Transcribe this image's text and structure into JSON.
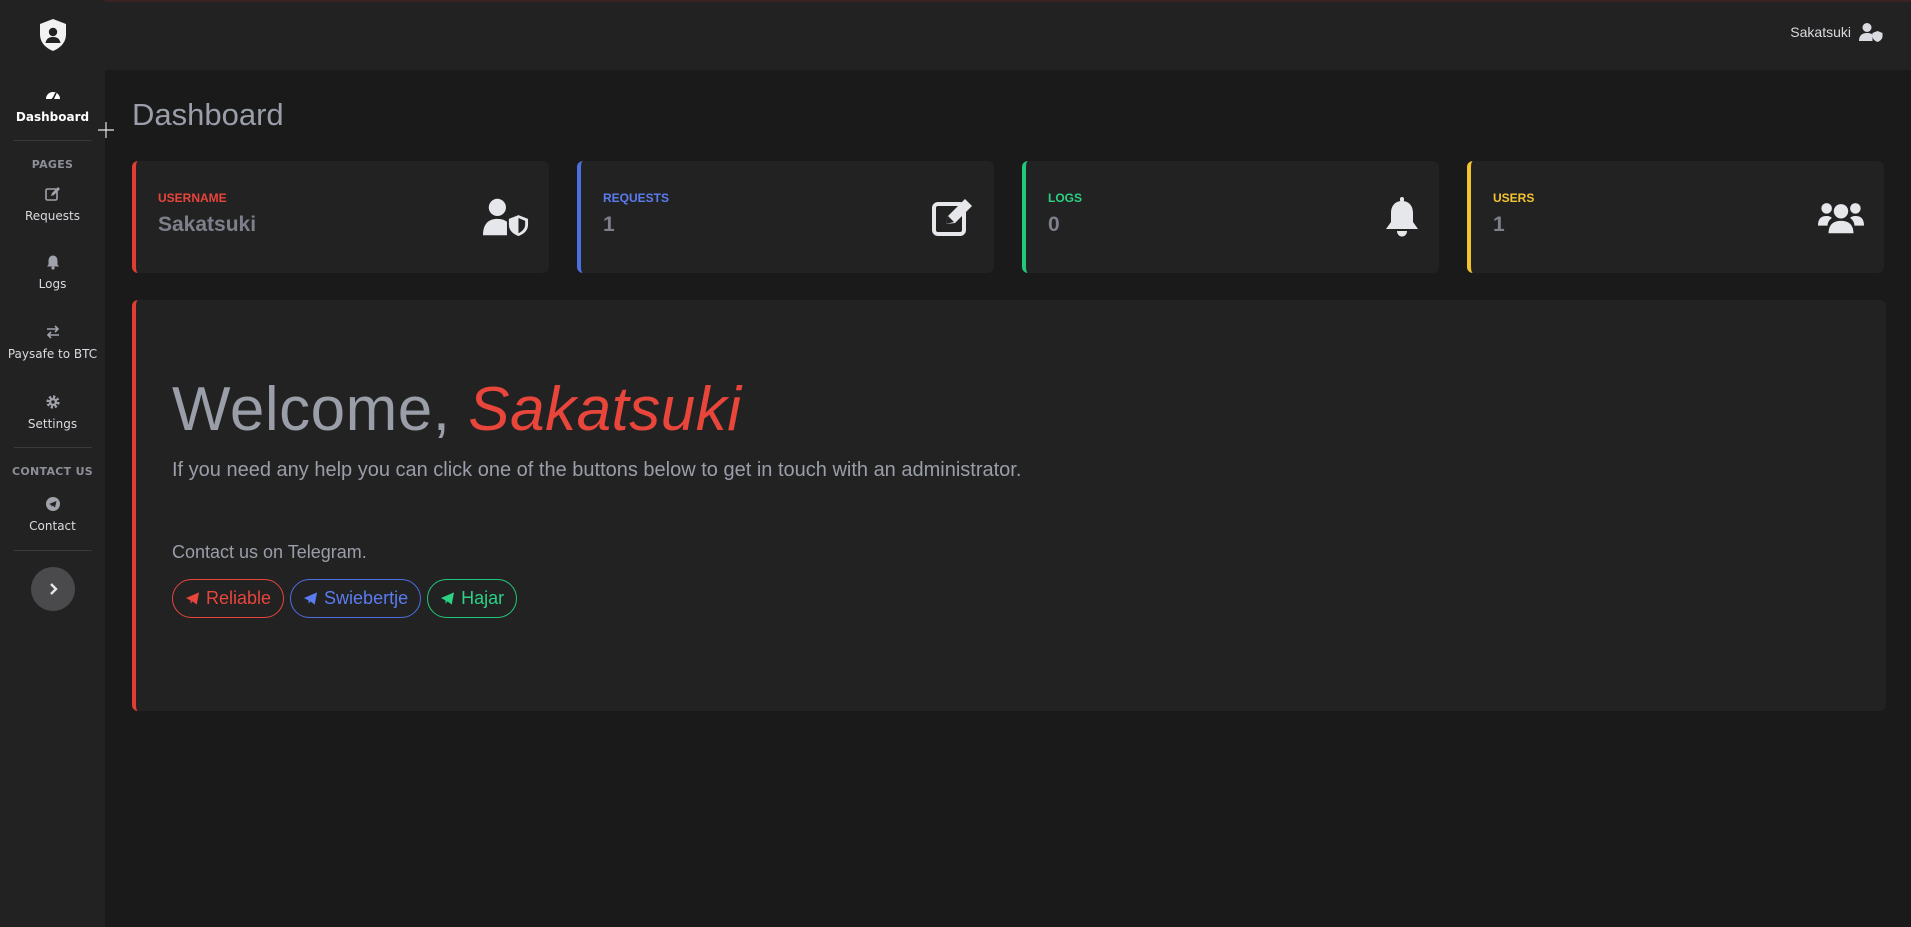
{
  "sidebar": {
    "brand_icon": "shield-user-icon",
    "items": [
      {
        "label": "Dashboard",
        "icon": "gauge-icon",
        "active": true
      },
      {
        "label": "Requests",
        "icon": "edit-icon"
      },
      {
        "label": "Logs",
        "icon": "bell-icon"
      },
      {
        "label": "Paysafe to BTC",
        "icon": "exchange-icon"
      },
      {
        "label": "Settings",
        "icon": "gear-icon"
      },
      {
        "label": "Contact",
        "icon": "telegram-icon"
      }
    ],
    "headings": {
      "pages": "PAGES",
      "contact": "CONTACT US"
    },
    "toggle_icon": "chevron-right-icon"
  },
  "topbar": {
    "username": "Sakatsuki",
    "user_icon": "user-shield-icon"
  },
  "page": {
    "title": "Dashboard"
  },
  "cards": [
    {
      "label": "USERNAME",
      "value": "Sakatsuki",
      "color": "#e03d33",
      "icon": "user-shield-icon"
    },
    {
      "label": "REQUESTS",
      "value": "1",
      "color": "#4e6fe0",
      "icon": "edit-icon"
    },
    {
      "label": "LOGS",
      "value": "0",
      "color": "#22c77a",
      "icon": "bell-icon"
    },
    {
      "label": "USERS",
      "value": "1",
      "color": "#f4c430",
      "icon": "users-icon"
    }
  ],
  "welcome": {
    "greeting": "Welcome,",
    "name": "Sakatsuki",
    "subtitle": "If you need any help you can click one of the buttons below to get in touch with an administrator.",
    "contact_note": "Contact us on Telegram.",
    "buttons": [
      {
        "label": "Reliable",
        "color": "#e8453b"
      },
      {
        "label": "Swiebertje",
        "color": "#4e6fe0"
      },
      {
        "label": "Hajar",
        "color": "#22c77a"
      }
    ]
  }
}
